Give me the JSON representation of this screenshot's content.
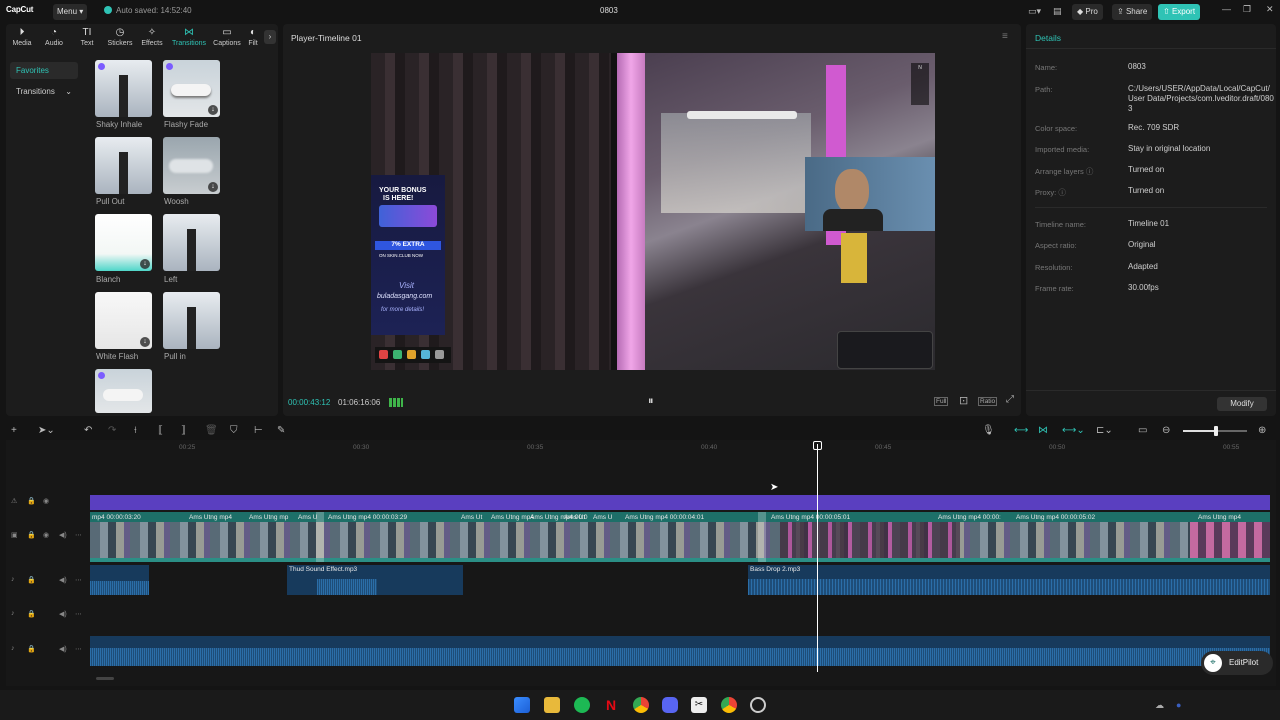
{
  "app": {
    "logo": "CapCut",
    "menu_label": "Menu",
    "autosave": "Auto saved: 14:52:40",
    "project_title": "0803",
    "pro_label": "Pro",
    "share_label": "Share",
    "export_label": "Export"
  },
  "left_panel": {
    "tabs": [
      {
        "label": "Media",
        "icon": "media-icon"
      },
      {
        "label": "Audio",
        "icon": "audio-icon"
      },
      {
        "label": "Text",
        "icon": "text-icon"
      },
      {
        "label": "Stickers",
        "icon": "stickers-icon"
      },
      {
        "label": "Effects",
        "icon": "effects-icon"
      },
      {
        "label": "Transitions",
        "icon": "transitions-icon"
      },
      {
        "label": "Captions",
        "icon": "captions-icon"
      },
      {
        "label": "Filt",
        "icon": "filters-icon"
      }
    ],
    "nav": {
      "favorites": "Favorites",
      "transitions": "Transitions"
    },
    "items": [
      {
        "label": "Shaky Inhale"
      },
      {
        "label": "Flashy Fade"
      },
      {
        "label": "Pull Out"
      },
      {
        "label": "Woosh"
      },
      {
        "label": "Blanch"
      },
      {
        "label": "Left"
      },
      {
        "label": "White Flash"
      },
      {
        "label": "Pull in"
      }
    ]
  },
  "player": {
    "title": "Player-Timeline 01",
    "current_time": "00:00:43:12",
    "total_time": "01:06:16:06",
    "full_label": "Full",
    "ratio_label": "Ratio",
    "overlay": {
      "bonus_line1": "YOUR BONUS",
      "bonus_line2": "IS HERE!",
      "extra": "7% EXTRA",
      "skin": "ON SKIN.CLUB NOW",
      "visit": "Visit",
      "site": "buladasgang.com",
      "more": "for more details!"
    }
  },
  "details": {
    "header": "Details",
    "rows": [
      {
        "key": "Name:",
        "value": "0803"
      },
      {
        "key": "Path:",
        "value": "C:/Users/USER/AppData/Local/CapCut/User Data/Projects/com.lveditor.draft/0803"
      },
      {
        "key": "Color space:",
        "value": "Rec. 709 SDR"
      },
      {
        "key": "Imported media:",
        "value": "Stay in original location"
      },
      {
        "key": "Arrange layers",
        "value": "Turned on"
      },
      {
        "key": "Proxy:",
        "value": "Turned on"
      },
      {
        "key": "Timeline name:",
        "value": "Timeline 01"
      },
      {
        "key": "Aspect ratio:",
        "value": "Original"
      },
      {
        "key": "Resolution:",
        "value": "Adapted"
      },
      {
        "key": "Frame rate:",
        "value": "30.00fps"
      }
    ],
    "modify_label": "Modify"
  },
  "timeline": {
    "ruler": [
      "00:25",
      "00:30",
      "00:35",
      "00:40",
      "00:45",
      "00:50",
      "00:55"
    ],
    "video_clips": [
      {
        "label": "mp4  00:00:03:20"
      },
      {
        "label": "Ams Utng mp4"
      },
      {
        "label": "Ams Utng mp"
      },
      {
        "label": "Ams U"
      },
      {
        "label": "Ams Utng mp4  00:00:03:29"
      },
      {
        "label": "Ams Ut"
      },
      {
        "label": "Ams Utng mp4"
      },
      {
        "label": "Ams Utng mp4  00:0"
      },
      {
        "label": "Ams Ut"
      },
      {
        "label": "Ams U"
      },
      {
        "label": "Ams Utng mp4  00:00:04:01"
      },
      {
        "label": "Ams Utng mp4  00:00:05:01"
      },
      {
        "label": "Ams Utng mp4  00:00:"
      },
      {
        "label": "Ams Utng mp4  00:00:05:02"
      },
      {
        "label": "Ams Utng mp4"
      }
    ],
    "audio_clips": [
      {
        "label": "Thud Sound Effect.mp3"
      },
      {
        "label": "Bass Drop 2.mp3"
      }
    ],
    "editpilot_label": "EditPilot"
  },
  "colors": {
    "accent": "#2fc3b5",
    "video_track": "#1d6f68",
    "audio_track": "#173a5c",
    "purple_track": "#5a3fc0"
  }
}
